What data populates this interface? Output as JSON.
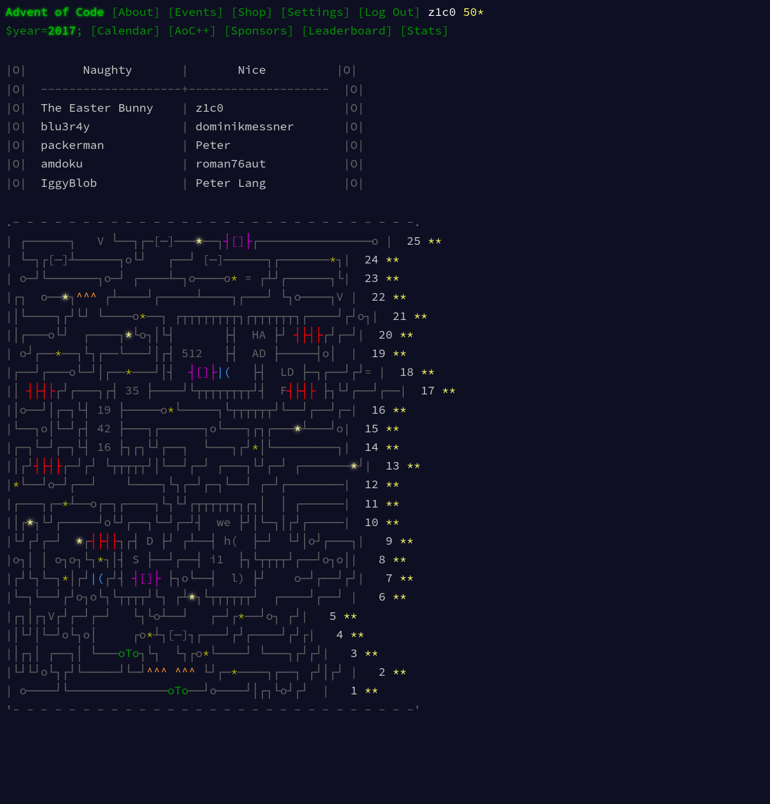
{
  "header": {
    "title": "Advent of Code",
    "nav1": [
      "[About]",
      "[Events]",
      "[Shop]",
      "[Settings]",
      "[Log Out]"
    ],
    "user": "z1c0",
    "stars": "50*",
    "year_prefix": "$year=",
    "year": "2017",
    "year_suffix": ";",
    "nav2": [
      "[Calendar]",
      "[AoC++]",
      "[Sponsors]",
      "[Leaderboard]",
      "[Stats]"
    ]
  },
  "list": {
    "naughty_header": "Naughty",
    "nice_header": "Nice",
    "rows": [
      {
        "naughty": "The Easter Bunny",
        "nice": "z1c0"
      },
      {
        "naughty": "blu3r4y",
        "nice": "dominikmessner"
      },
      {
        "naughty": "packerman",
        "nice": "Peter"
      },
      {
        "naughty": "amdoku",
        "nice": "roman76aut"
      },
      {
        "naughty": "IggyBlob",
        "nice": "Peter Lang"
      }
    ]
  },
  "calendar": {
    "days": [
      {
        "day": 25,
        "stars": "**"
      },
      {
        "day": 24,
        "stars": "**"
      },
      {
        "day": 23,
        "stars": "**"
      },
      {
        "day": 22,
        "stars": "**"
      },
      {
        "day": 21,
        "stars": "**"
      },
      {
        "day": 20,
        "stars": "**"
      },
      {
        "day": 19,
        "stars": "**"
      },
      {
        "day": 18,
        "stars": "**"
      },
      {
        "day": 17,
        "stars": "**"
      },
      {
        "day": 16,
        "stars": "**"
      },
      {
        "day": 15,
        "stars": "**"
      },
      {
        "day": 14,
        "stars": "**"
      },
      {
        "day": 13,
        "stars": "**"
      },
      {
        "day": 12,
        "stars": "**"
      },
      {
        "day": 11,
        "stars": "**"
      },
      {
        "day": 10,
        "stars": "**"
      },
      {
        "day": 9,
        "stars": "**"
      },
      {
        "day": 8,
        "stars": "**"
      },
      {
        "day": 7,
        "stars": "**"
      },
      {
        "day": 6,
        "stars": "**"
      },
      {
        "day": 5,
        "stars": "**"
      },
      {
        "day": 4,
        "stars": "**"
      },
      {
        "day": 3,
        "stars": "**"
      },
      {
        "day": 2,
        "stars": "**"
      },
      {
        "day": 1,
        "stars": "**"
      }
    ]
  }
}
